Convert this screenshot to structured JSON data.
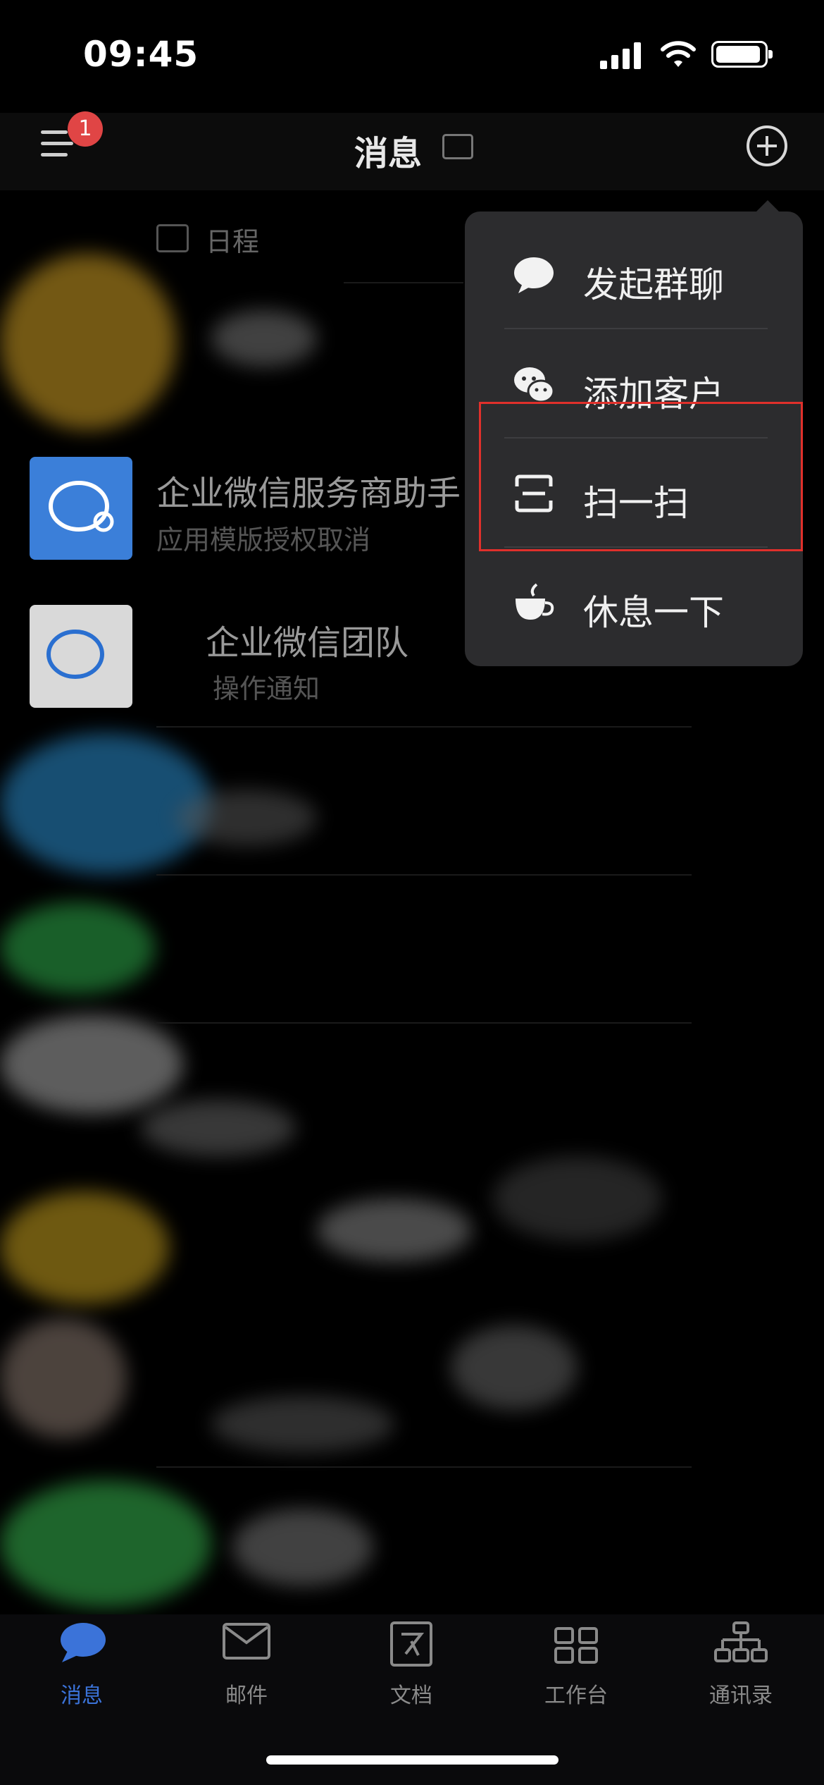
{
  "status_bar": {
    "time": "09:45"
  },
  "header": {
    "title": "消息",
    "badge_count": "1"
  },
  "quick_entries": [
    {
      "label": "日程"
    }
  ],
  "conversations": [
    {
      "title": "企业微信服务商助手",
      "subtitle": "应用模版授权取消",
      "avatar_color": "#3b7fd9"
    },
    {
      "title": "企业微信团队",
      "subtitle": "操作通知",
      "avatar_color": "#d9d9d9"
    }
  ],
  "dropdown_menu": {
    "items": [
      {
        "label": "发起群聊",
        "icon": "chat-bubble-icon"
      },
      {
        "label": "添加客户",
        "icon": "wechat-icon"
      },
      {
        "label": "扫一扫",
        "icon": "scan-icon",
        "highlighted": true
      },
      {
        "label": "休息一下",
        "icon": "coffee-cup-icon"
      }
    ]
  },
  "tab_bar": {
    "tabs": [
      {
        "label": "消息",
        "icon": "message-icon",
        "active": true
      },
      {
        "label": "邮件",
        "icon": "mail-icon",
        "active": false
      },
      {
        "label": "文档",
        "icon": "document-icon",
        "active": false
      },
      {
        "label": "工作台",
        "icon": "workbench-icon",
        "active": false
      },
      {
        "label": "通讯录",
        "icon": "contacts-icon",
        "active": false
      }
    ],
    "active_color": "#3b73d9",
    "inactive_color": "#8a8a8a"
  }
}
